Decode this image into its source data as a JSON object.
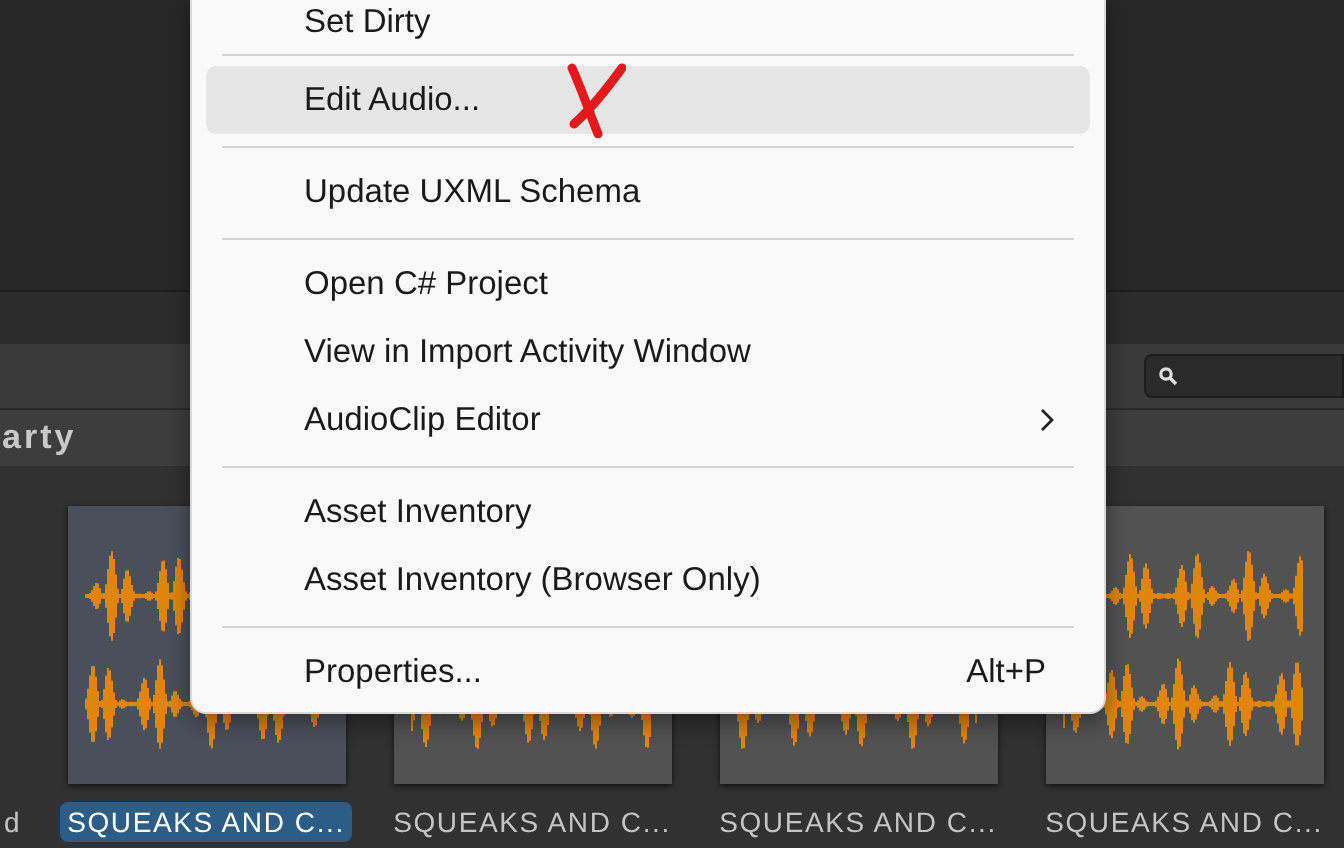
{
  "panel": {
    "header": "arty"
  },
  "assets": {
    "partial_label": "d",
    "tiles": [
      {
        "label": "SQUEAKS AND C...",
        "selected": true
      },
      {
        "label": "SQUEAKS AND C...",
        "selected": false
      },
      {
        "label": "SQUEAKS AND C...",
        "selected": false
      },
      {
        "label": "SQUEAKS AND C...",
        "selected": false
      }
    ]
  },
  "context_menu": {
    "items": [
      {
        "kind": "item",
        "label": "Set Dirty",
        "selected": false,
        "annotated": false
      },
      {
        "kind": "separator"
      },
      {
        "kind": "item",
        "label": "Edit Audio...",
        "selected": true,
        "annotated": true
      },
      {
        "kind": "separator"
      },
      {
        "kind": "item",
        "label": "Update UXML Schema",
        "selected": false,
        "annotated": false
      },
      {
        "kind": "separator"
      },
      {
        "kind": "item",
        "label": "Open C# Project",
        "selected": false,
        "annotated": false
      },
      {
        "kind": "item",
        "label": "View in Import Activity Window",
        "selected": false,
        "annotated": false
      },
      {
        "kind": "submenu",
        "label": "AudioClip Editor",
        "selected": false,
        "annotated": false
      },
      {
        "kind": "separator"
      },
      {
        "kind": "item",
        "label": "Asset Inventory",
        "selected": false,
        "annotated": false
      },
      {
        "kind": "item",
        "label": "Asset Inventory (Browser Only)",
        "selected": false,
        "annotated": false
      },
      {
        "kind": "separator"
      },
      {
        "kind": "item",
        "label": "Properties...",
        "shortcut": "Alt+P",
        "selected": false,
        "annotated": false
      }
    ]
  }
}
